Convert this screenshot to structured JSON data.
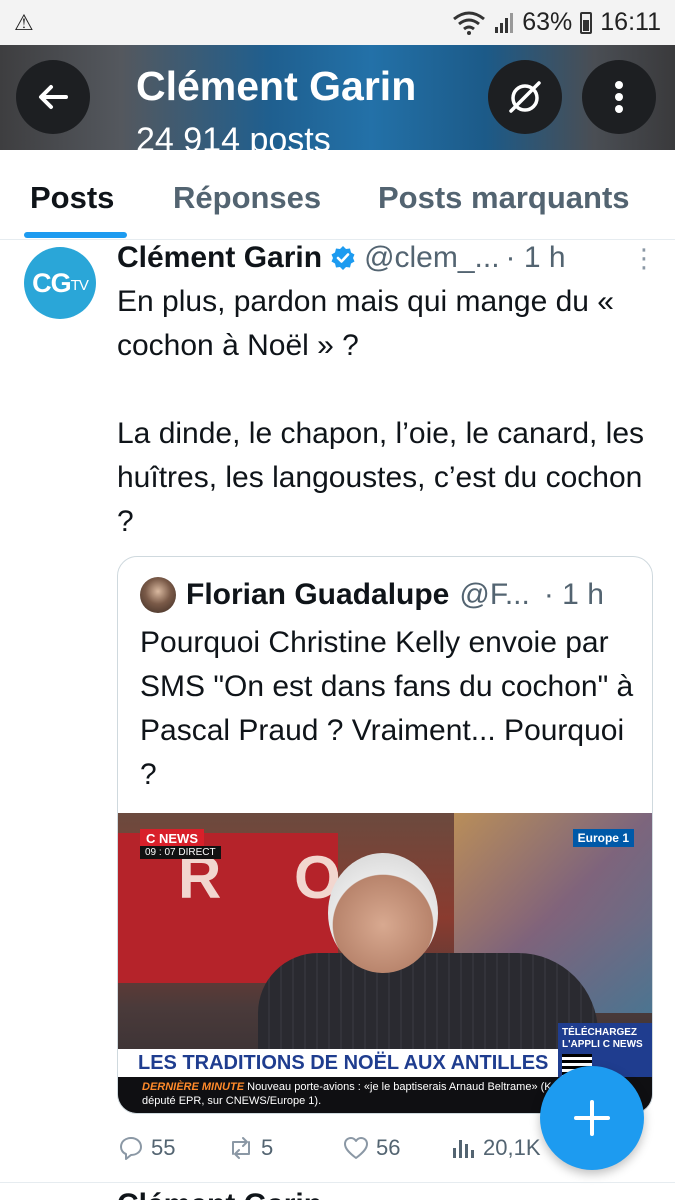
{
  "status_bar": {
    "warning_icon": "warning-icon",
    "battery": "63%",
    "time": "16:11"
  },
  "header": {
    "title": "Clément Garin",
    "subtitle": "24 914 posts"
  },
  "tabs": [
    {
      "label": "Posts",
      "active": true
    },
    {
      "label": "Réponses",
      "active": false
    },
    {
      "label": "Posts marquants",
      "active": false
    }
  ],
  "post": {
    "avatar_text": "CG",
    "avatar_text_small": "TV",
    "author": "Clément Garin",
    "handle": "@clem_...",
    "time": "· 1 h",
    "text": "En plus, pardon mais qui mange du « cochon à Noël » ?\n\nLa dinde, le chapon, l’oie, le canard, les huîtres, les langoustes, c’est du cochon ?",
    "quote": {
      "author": "Florian Guadalupe",
      "handle": "@F...",
      "time": "· 1 h",
      "text": "Pourquoi Christine Kelly envoie par SMS \"On est dans fans du cochon\" à Pascal Praud ? Vraiment... Pourquoi ?",
      "media": {
        "channel": "C NEWS",
        "ident": "09 : 07 DIRECT",
        "partner": "Europe 1",
        "download": "TÉLÉCHARGEZ L'APPLI C NEWS",
        "banner": "LES TRADITIONS DE NOËL AUX ANTILLES",
        "ticker_label": "DERNIÈRE MINUTE",
        "ticker_text": "Nouveau porte-avions : «je le baptiserais Arnaud Beltrame» (Karl Olive, député EPR, sur CNEWS/Europe 1).",
        "bg_letters": "R O"
      }
    },
    "actions": {
      "replies": "55",
      "reposts": "5",
      "likes": "56",
      "views": "20,1K"
    }
  },
  "next_post_author": "Clément Garin",
  "colors": {
    "accent": "#1d9bf0",
    "text": "#0f1419",
    "muted": "#536471"
  }
}
